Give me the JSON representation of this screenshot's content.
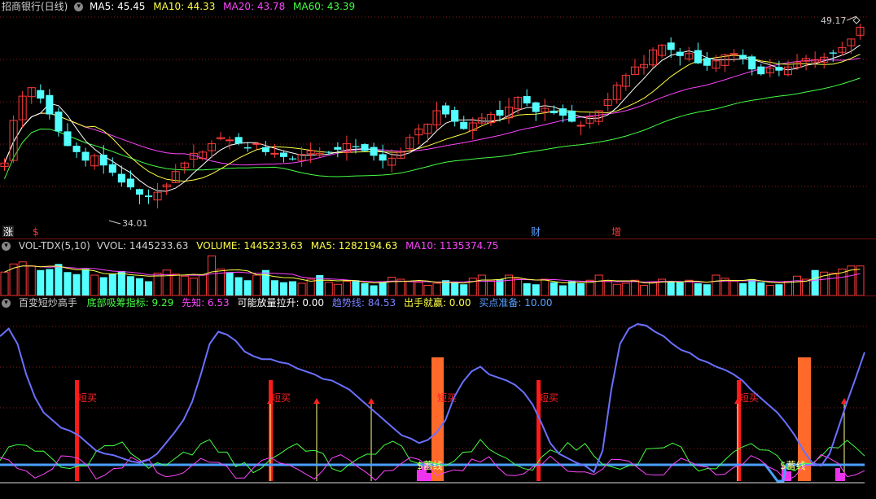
{
  "colors": {
    "up": "#ff3b3b",
    "down": "#54ffff",
    "ma5": "#ffffff",
    "ma10": "#ffff44",
    "ma20": "#ff44ff",
    "ma60": "#44ff44",
    "grid": "#8b1a1a"
  },
  "main_panel": {
    "icon": "circle-down-icon",
    "title": "招商银行(日线)",
    "ma5": "MA5: 45.45",
    "ma10": "MA10: 44.33",
    "ma20": "MA20: 43.78",
    "ma60": "MA60: 43.39",
    "high_marker": "49.17",
    "low_marker": "34.01",
    "badge_zhang": "涨",
    "badge_dollar": "$",
    "event_cai": "财",
    "event_zeng": "增"
  },
  "vol_panel": {
    "icon": "circle-down-icon",
    "title": "VOL-TDX(5,10)",
    "vvol": "VVOL: 1445233.63",
    "volume": "VOLUME: 1445233.63",
    "ma5": "MA5: 1282194.63",
    "ma10": "MA10: 1135374.75"
  },
  "ind_panel": {
    "icon": "circle-down-icon",
    "title": "百变短炒高手",
    "dibu": "底部吸筹指标: 9.29",
    "xianzhi": "先知: 6.53",
    "fangliang": "可能放量拉升: 0.00",
    "qushi": "趋势线: 84.53",
    "chushou": "出手就赢: 0.00",
    "maidian": "买点准备: 10.00",
    "signal_duanmai": "短买",
    "signal_xuxian": "$蓄线"
  },
  "chart_data": [
    {
      "type": "candlestick",
      "title": "招商银行(日线)",
      "y_high_label": 49.17,
      "y_low_label": 34.01,
      "ylim": [
        33.0,
        50.0
      ],
      "series": [
        {
          "name": "MA5",
          "last": 45.45
        },
        {
          "name": "MA10",
          "last": 44.33
        },
        {
          "name": "MA20",
          "last": 43.78
        },
        {
          "name": "MA60",
          "last": 43.39
        }
      ],
      "close_path": [
        38.0,
        41.5,
        43.5,
        44.2,
        43.3,
        42.0,
        40.6,
        39.4,
        38.9,
        38.2,
        38.6,
        37.8,
        37.2,
        36.4,
        36.0,
        35.4,
        35.2,
        35.6,
        36.2,
        37.3,
        38.0,
        38.8,
        38.9,
        39.6,
        40.1,
        39.9,
        39.6,
        39.2,
        39.6,
        38.9,
        38.8,
        38.5,
        38.3,
        38.7,
        39.0,
        38.8,
        38.9,
        39.1,
        39.6,
        39.3,
        39.0,
        38.6,
        38.2,
        38.4,
        38.9,
        40.1,
        40.8,
        41.2,
        42.3,
        42.0,
        41.4,
        40.8,
        41.3,
        41.7,
        42.0,
        41.9,
        42.6,
        43.4,
        42.9,
        42.2,
        42.5,
        42.1,
        41.9,
        41.4,
        41.1,
        41.8,
        42.3,
        43.2,
        44.4,
        45.2,
        45.9,
        46.1,
        47.3,
        47.7,
        47.3,
        46.8,
        47.0,
        46.2,
        46.0,
        46.4,
        46.9,
        47.0,
        46.6,
        45.7,
        45.3,
        45.8,
        45.6,
        45.9,
        46.3,
        46.6,
        46.5,
        46.7,
        47.0,
        47.5,
        48.2,
        49.17
      ]
    },
    {
      "type": "bar",
      "title": "VOL-TDX(5,10)",
      "series": [
        {
          "name": "VVOL",
          "last": 1445233.63
        },
        {
          "name": "VOLUME",
          "last": 1445233.63
        },
        {
          "name": "MA5",
          "last": 1282194.63
        },
        {
          "name": "MA10",
          "last": 1135374.75
        }
      ],
      "ylim": [
        0,
        2000000
      ],
      "values": [
        1150000,
        1550000,
        1650000,
        1450000,
        1250000,
        1300000,
        1550000,
        1150000,
        1050000,
        1300000,
        1000000,
        900000,
        1050000,
        1200000,
        950000,
        850000,
        700000,
        1100000,
        1250000,
        1050000,
        950000,
        850000,
        1000000,
        1950000,
        1300000,
        1150000,
        900000,
        750000,
        1000000,
        1250000,
        750000,
        650000,
        700000,
        600000,
        800000,
        1000000,
        650000,
        550000,
        700000,
        750000,
        600000,
        500000,
        650000,
        900000,
        800000,
        700000,
        650000,
        500000,
        600000,
        750000,
        650000,
        550000,
        850000,
        1000000,
        750000,
        800000,
        1000000,
        850000,
        600000,
        550000,
        800000,
        650000,
        500000,
        700000,
        600000,
        750000,
        1000000,
        700000,
        550000,
        600000,
        750000,
        500000,
        650000,
        800000,
        700000,
        650000,
        750000,
        600000,
        550000,
        1000000,
        850000,
        700000,
        600000,
        800000,
        650000,
        500000,
        550000,
        700000,
        950000,
        800000,
        1250000,
        1150000,
        1100000,
        1300000,
        1450000,
        1450000
      ]
    },
    {
      "type": "line",
      "title": "百变短炒高手",
      "ylim": [
        0,
        110
      ],
      "series": [
        {
          "name": "底部吸筹指标",
          "last": 9.29
        },
        {
          "name": "先知",
          "last": 6.53
        },
        {
          "name": "可能放量拉升",
          "last": 0.0
        },
        {
          "name": "趋势线",
          "last": 84.53
        },
        {
          "name": "出手就赢",
          "last": 0.0
        },
        {
          "name": "买点准备",
          "last": 10.0
        }
      ],
      "trend_path": [
        95,
        100,
        90,
        70,
        55,
        45,
        40,
        35,
        33,
        30,
        25,
        20,
        18,
        17,
        15,
        13,
        12,
        14,
        18,
        25,
        32,
        40,
        52,
        70,
        90,
        98,
        96,
        92,
        85,
        82,
        80,
        80,
        78,
        77,
        74,
        72,
        70,
        67,
        66,
        63,
        60,
        55,
        50,
        45,
        40,
        35,
        30,
        28,
        25,
        27,
        32,
        40,
        55,
        65,
        72,
        75,
        70,
        68,
        66,
        63,
        58,
        50,
        38,
        25,
        18,
        15,
        12,
        10,
        6,
        20,
        60,
        90,
        100,
        103,
        102,
        98,
        95,
        90,
        86,
        84,
        80,
        78,
        75,
        73,
        70,
        66,
        60,
        55,
        50,
        45,
        38,
        30,
        20,
        12,
        10,
        18,
        35,
        52,
        68,
        84.53
      ]
    }
  ]
}
